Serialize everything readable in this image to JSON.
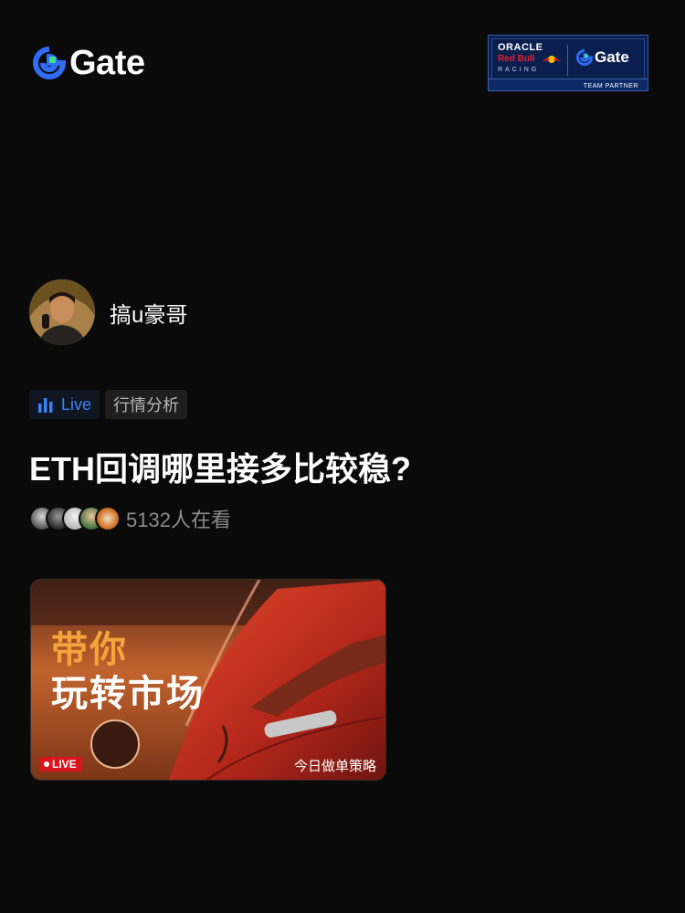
{
  "header": {
    "logo_text": "Gate",
    "partner": {
      "oracle": "ORACLE",
      "redbull": "Red Bull",
      "racing": "RACING",
      "gate": "Gate",
      "team": "TEAM PARTNER"
    }
  },
  "streamer": {
    "name": "搞u豪哥"
  },
  "tags": {
    "live": "Live",
    "category": "行情分析"
  },
  "stream": {
    "title": "ETH回调哪里接多比较稳?",
    "viewers": "5132人在看"
  },
  "card": {
    "line1": "带你",
    "line2": "玩转市场",
    "live_badge": "LIVE",
    "caption": "今日做单策略"
  },
  "colors": {
    "background": "#0a0a0a",
    "live_blue": "#3b82f6",
    "live_red": "#d9141c",
    "card_orange": "#f5a43a"
  }
}
